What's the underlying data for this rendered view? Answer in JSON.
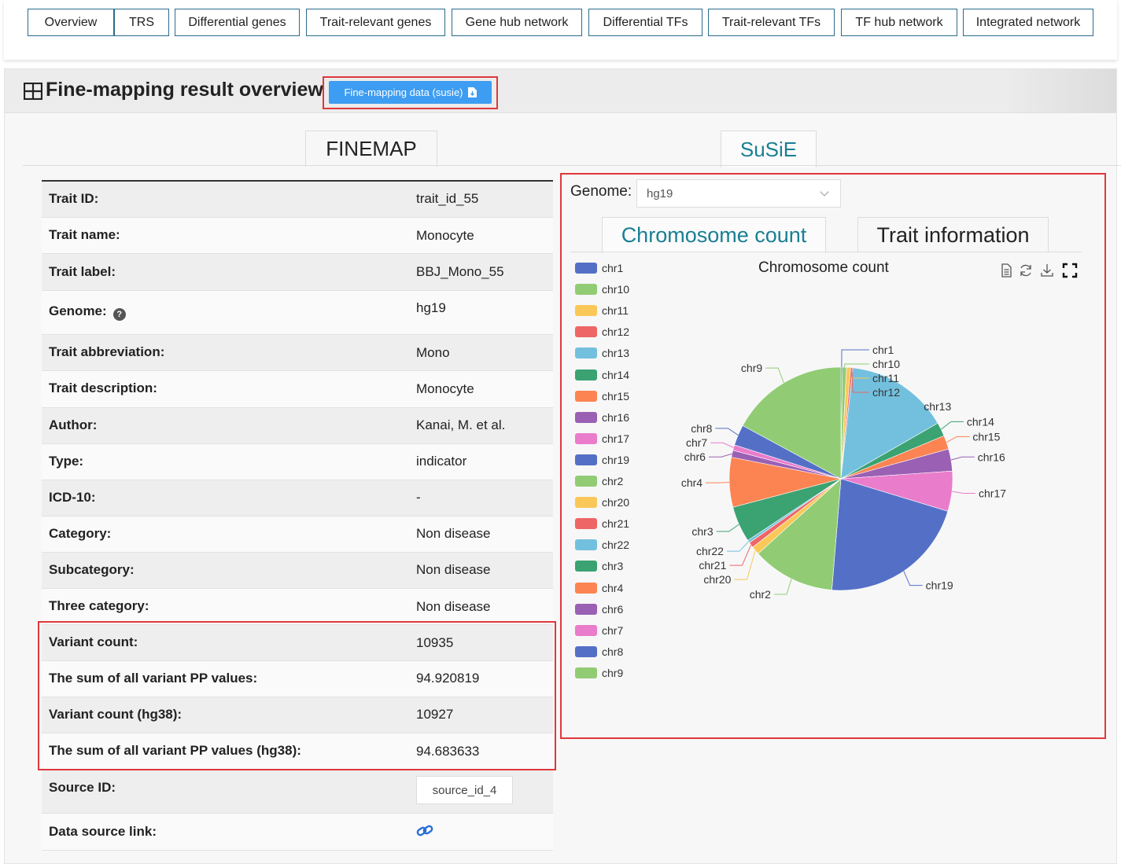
{
  "nav": [
    "Overview",
    "TRS",
    "Differential genes",
    "Trait-relevant genes",
    "Gene hub network",
    "Differential TFs",
    "Trait-relevant TFs",
    "TF hub network",
    "Integrated network"
  ],
  "panel": {
    "title": "Fine-mapping result overview",
    "download_label": "Fine-mapping data (susie)"
  },
  "tabs": {
    "finemap": "FINEMAP",
    "susie": "SuSiE"
  },
  "table": [
    {
      "label": "Trait ID:",
      "value": "trait_id_55"
    },
    {
      "label": "Trait name:",
      "value": "Monocyte"
    },
    {
      "label": "Trait label:",
      "value": "BBJ_Mono_55"
    },
    {
      "label": "Genome:",
      "value": "hg19"
    },
    {
      "label": "Trait abbreviation:",
      "value": "Mono"
    },
    {
      "label": "Trait description:",
      "value": "Monocyte"
    },
    {
      "label": "Author:",
      "value": "Kanai, M. et al."
    },
    {
      "label": "Type:",
      "value": "indicator"
    },
    {
      "label": "ICD-10:",
      "value": "-"
    },
    {
      "label": "Category:",
      "value": "Non disease"
    },
    {
      "label": "Subcategory:",
      "value": "Non disease"
    },
    {
      "label": "Three category:",
      "value": "Non disease"
    },
    {
      "label": "Variant count:",
      "value": "10935"
    },
    {
      "label": "The sum of all variant PP values:",
      "value": "94.920819"
    },
    {
      "label": "Variant count (hg38):",
      "value": "10927"
    },
    {
      "label": "The sum of all variant PP values (hg38):",
      "value": "94.683633"
    },
    {
      "label": "Source ID:",
      "value": "source_id_4"
    },
    {
      "label": "Data source link:",
      "value": ""
    }
  ],
  "genome_select": {
    "label": "Genome:",
    "value": "hg19"
  },
  "inner_tabs": {
    "chromosome": "Chromosome count",
    "trait": "Trait information"
  },
  "icons": {
    "help": "question-circle-icon",
    "link": "link-icon",
    "grid": "grid-icon",
    "download": "file-download-icon"
  },
  "colors": {
    "accent": "#1a7f93",
    "button": "#3d9df2",
    "highlight": "#e0373c"
  },
  "chart_data": {
    "type": "pie",
    "title": "Chromosome count",
    "legend": [
      "chr1",
      "chr10",
      "chr11",
      "chr12",
      "chr13",
      "chr14",
      "chr15",
      "chr16",
      "chr17",
      "chr19",
      "chr2",
      "chr20",
      "chr21",
      "chr22",
      "chr3",
      "chr4",
      "chr6",
      "chr7",
      "chr8",
      "chr9"
    ],
    "slices": [
      {
        "name": "chr1",
        "value": 0.2,
        "color": "#5470c6"
      },
      {
        "name": "chr10",
        "value": 0.6,
        "color": "#91cc75"
      },
      {
        "name": "chr11",
        "value": 0.6,
        "color": "#fac858"
      },
      {
        "name": "chr12",
        "value": 0.3,
        "color": "#ee6666"
      },
      {
        "name": "chr13",
        "value": 15.0,
        "color": "#73c0de"
      },
      {
        "name": "chr14",
        "value": 2.0,
        "color": "#3ba272"
      },
      {
        "name": "chr15",
        "value": 2.0,
        "color": "#fc8452"
      },
      {
        "name": "chr16",
        "value": 3.2,
        "color": "#9a60b4"
      },
      {
        "name": "chr17",
        "value": 5.8,
        "color": "#ea7ccc"
      },
      {
        "name": "chr19",
        "value": 21.6,
        "color": "#5470c6"
      },
      {
        "name": "chr2",
        "value": 12.0,
        "color": "#91cc75"
      },
      {
        "name": "chr20",
        "value": 1.2,
        "color": "#fac858"
      },
      {
        "name": "chr21",
        "value": 0.8,
        "color": "#ee6666"
      },
      {
        "name": "chr22",
        "value": 0.4,
        "color": "#73c0de"
      },
      {
        "name": "chr3",
        "value": 5.2,
        "color": "#3ba272"
      },
      {
        "name": "chr4",
        "value": 7.2,
        "color": "#fc8452"
      },
      {
        "name": "chr6",
        "value": 1.0,
        "color": "#9a60b4"
      },
      {
        "name": "chr7",
        "value": 0.8,
        "color": "#ea7ccc"
      },
      {
        "name": "chr8",
        "value": 3.0,
        "color": "#5470c6"
      },
      {
        "name": "chr9",
        "value": 17.1,
        "color": "#91cc75"
      }
    ]
  }
}
